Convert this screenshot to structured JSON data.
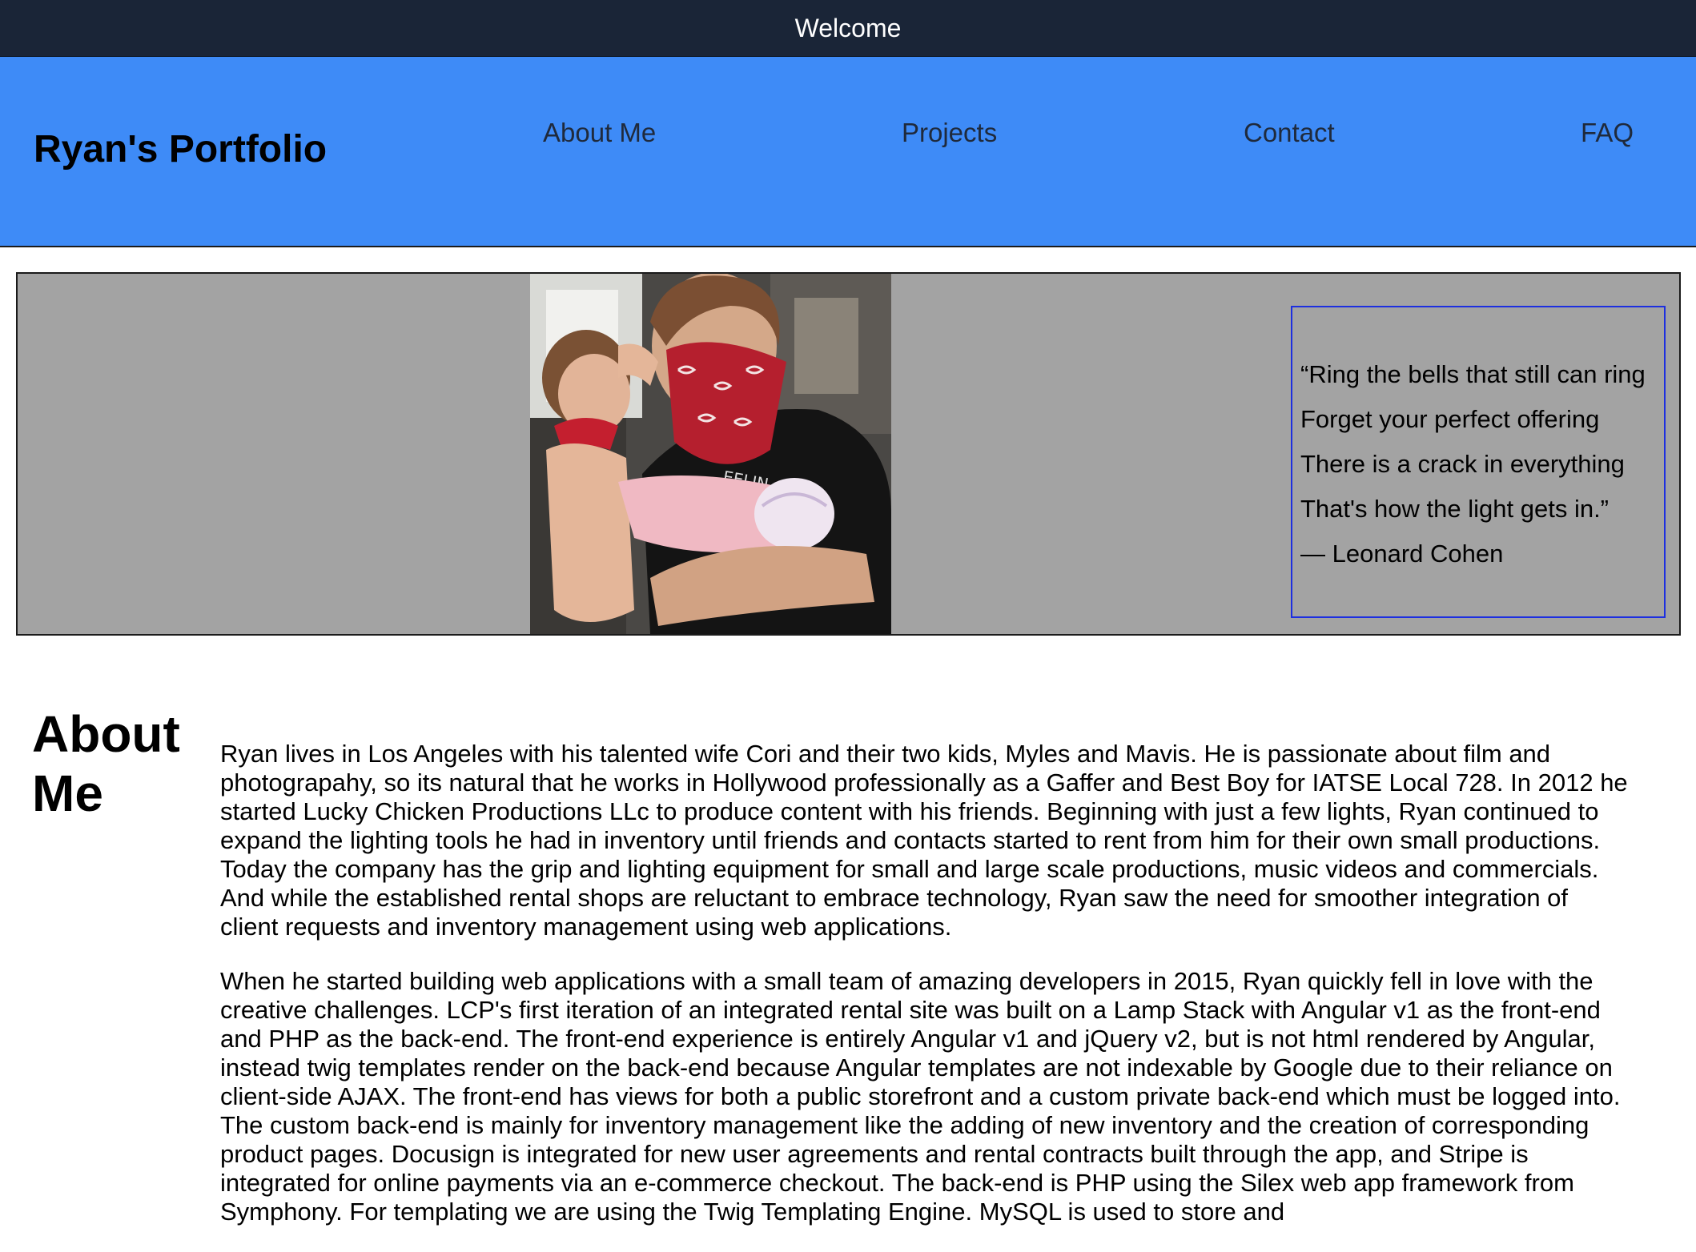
{
  "welcome_bar": {
    "text": "Welcome"
  },
  "navbar": {
    "title": "Ryan's Portfolio",
    "links": [
      {
        "label": "About Me"
      },
      {
        "label": "Projects"
      },
      {
        "label": "Contact"
      },
      {
        "label": "FAQ"
      }
    ]
  },
  "hero": {
    "quote": {
      "lines": [
        "“Ring the bells that still can ring",
        "Forget your perfect offering",
        "There is a crack in everything",
        "That's how the light gets in.”",
        "— Leonard Cohen"
      ]
    }
  },
  "about": {
    "heading_line1": "About",
    "heading_line2": "Me",
    "paragraphs": [
      "Ryan lives in Los Angeles with his talented wife Cori and their two kids, Myles and Mavis. He is passionate about film and photograpahy, so its natural that he works in Hollywood professionally as a Gaffer and Best Boy for IATSE Local 728. In 2012 he started Lucky Chicken Productions LLc to produce content with his friends. Beginning with just a few lights, Ryan continued to expand the lighting tools he had in inventory until friends and contacts started to rent from him for their own small productions. Today the company has the grip and lighting equipment for small and large scale productions, music videos and commercials. And while the established rental shops are reluctant to embrace technology, Ryan saw the need for smoother integration of client requests and inventory management using web applications.",
      "When he started building web applications with a small team of amazing developers in 2015, Ryan quickly fell in love with the creative challenges. LCP's first iteration of an integrated rental site was built on a Lamp Stack with Angular v1 as the front-end and PHP as the back-end. The front-end experience is entirely Angular v1 and jQuery v2, but is not html rendered by Angular, instead twig templates render on the back-end because Angular templates are not indexable by Google due to their reliance on client-side AJAX. The front-end has views for both a public storefront and a custom private back-end which must be logged into. The custom back-end is mainly for inventory management like the adding of new inventory and the creation of corresponding product pages. Docusign is integrated for new user agreements and rental contracts built through the app, and Stripe is integrated for online payments via an e-commerce checkout. The back-end is PHP using the Silex web app framework from Symphony. For templating we are using the Twig Templating Engine. MySQL is used to store and"
    ]
  },
  "colors": {
    "welcome_bg": "#1a2537",
    "navbar_bg": "#3e8bf7",
    "hero_bg": "#a3a3a3",
    "quote_border": "#1d2fe0"
  }
}
